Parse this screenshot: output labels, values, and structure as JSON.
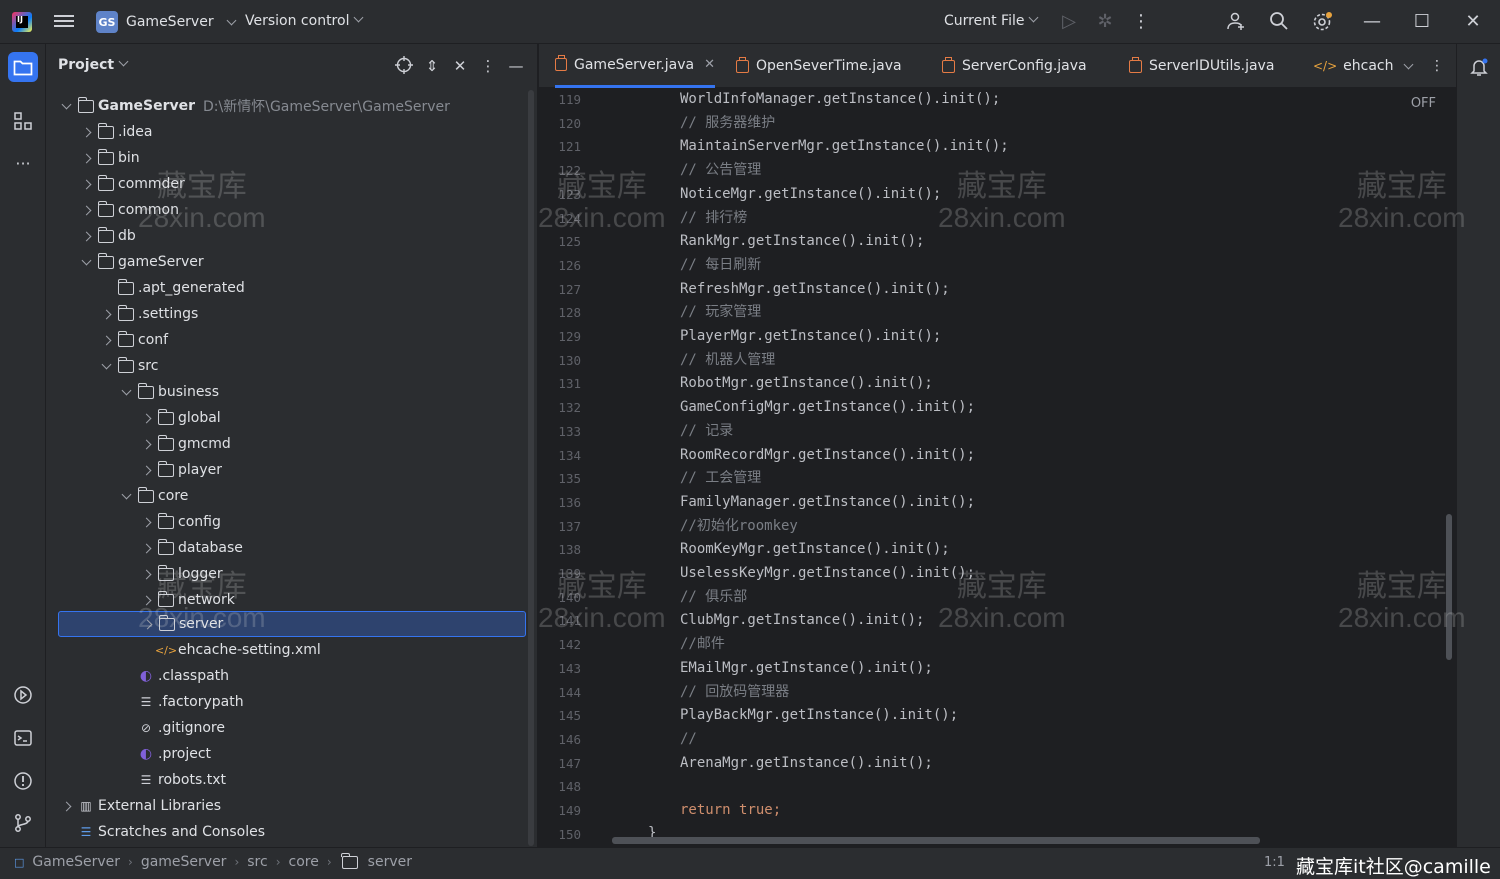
{
  "titlebar": {
    "project_badge": "GS",
    "project_name": "GameServer",
    "vcs_label": "Version control",
    "run_config": "Current File"
  },
  "project_panel": {
    "title": "Project",
    "root_name": "GameServer",
    "root_path": "D:\\新情怀\\GameServer\\GameServer",
    "items": [
      {
        "label": ".idea"
      },
      {
        "label": "bin"
      },
      {
        "label": "commder"
      },
      {
        "label": "common"
      },
      {
        "label": "db"
      },
      {
        "label": "gameServer"
      },
      {
        "label": ".apt_generated"
      },
      {
        "label": ".settings"
      },
      {
        "label": "conf"
      },
      {
        "label": "src"
      },
      {
        "label": "business"
      },
      {
        "label": "global"
      },
      {
        "label": "gmcmd"
      },
      {
        "label": "player"
      },
      {
        "label": "core"
      },
      {
        "label": "config"
      },
      {
        "label": "database"
      },
      {
        "label": "logger"
      },
      {
        "label": "network"
      },
      {
        "label": "server"
      },
      {
        "label": "ehcache-setting.xml"
      },
      {
        "label": ".classpath"
      },
      {
        "label": ".factorypath"
      },
      {
        "label": ".gitignore"
      },
      {
        "label": ".project"
      },
      {
        "label": "robots.txt"
      },
      {
        "label": "External Libraries"
      },
      {
        "label": "Scratches and Consoles"
      }
    ]
  },
  "editor": {
    "tabs": [
      {
        "label": "GameServer.java"
      },
      {
        "label": "OpenSeverTime.java"
      },
      {
        "label": "ServerConfig.java"
      },
      {
        "label": "ServerIDUtils.java"
      },
      {
        "label": "ehcach"
      }
    ],
    "inlay_label": "OFF",
    "line_numbers": [
      "119",
      "120",
      "121",
      "122",
      "123",
      "124",
      "125",
      "126",
      "127",
      "128",
      "129",
      "130",
      "131",
      "132",
      "133",
      "134",
      "135",
      "136",
      "137",
      "138",
      "139",
      "140",
      "141",
      "142",
      "143",
      "144",
      "145",
      "146",
      "147",
      "148",
      "149",
      "150"
    ],
    "lines": [
      "WorldInfoManager.getInstance().init();",
      "// 服务器维护",
      "MaintainServerMgr.getInstance().init();",
      "// 公告管理",
      "NoticeMgr.getInstance().init();",
      "// 排行榜",
      "RankMgr.getInstance().init();",
      "// 每日刷新",
      "RefreshMgr.getInstance().init();",
      "// 玩家管理",
      "PlayerMgr.getInstance().init();",
      "// 机器人管理",
      "RobotMgr.getInstance().init();",
      "GameConfigMgr.getInstance().init();",
      "// 记录",
      "RoomRecordMgr.getInstance().init();",
      "// 工会管理",
      "FamilyManager.getInstance().init();",
      "//初始化roomkey",
      "RoomKeyMgr.getInstance().init();",
      "UselessKeyMgr.getInstance().init();",
      "// 俱乐部",
      "ClubMgr.getInstance().init();",
      "//邮件",
      "EMailMgr.getInstance().init();",
      "// 回放码管理器",
      "PlayBackMgr.getInstance().init();",
      "//",
      "ArenaMgr.getInstance().init();",
      "",
      "true;",
      "}"
    ],
    "return_keyword": "return"
  },
  "statusbar": {
    "breadcrumbs": [
      "GameServer",
      "gameServer",
      "src",
      "core",
      "server"
    ],
    "caret_position": "1:1",
    "brand_text": "藏宝库it社区@camille"
  },
  "watermark": {
    "line1": "藏宝库",
    "line2": "28xin.com"
  }
}
